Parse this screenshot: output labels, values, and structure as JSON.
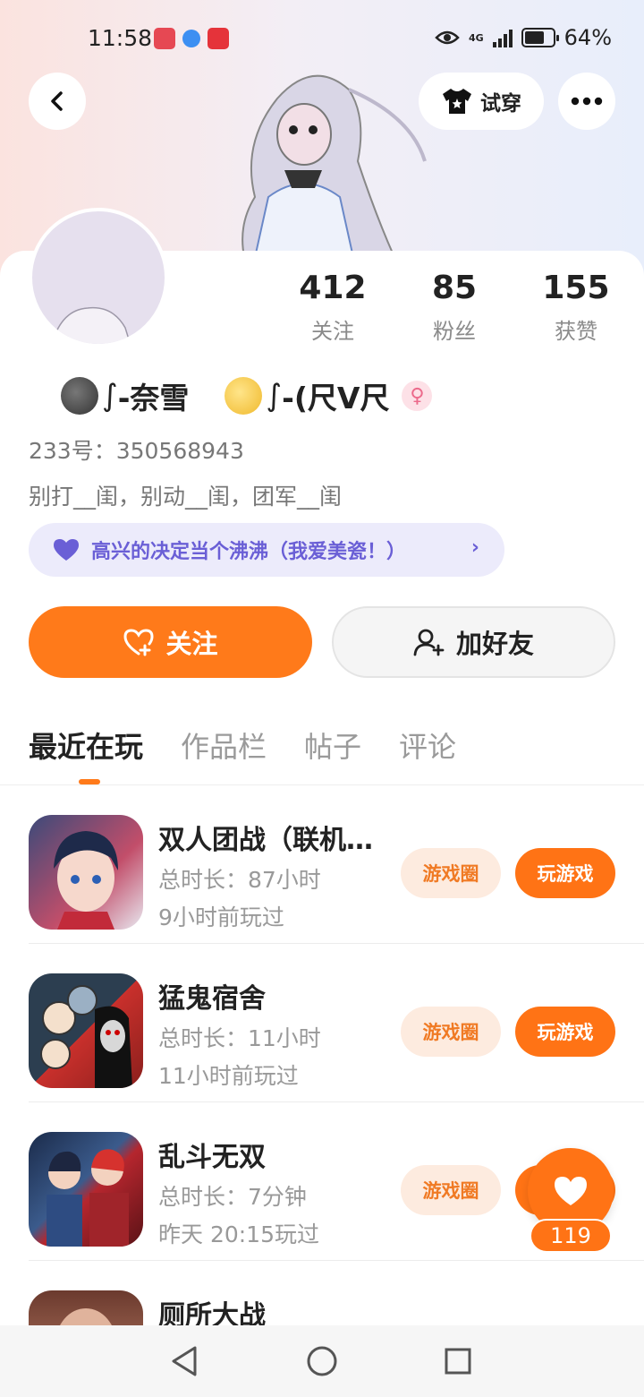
{
  "status_bar": {
    "time": "11:58",
    "signal_label": "4G",
    "battery": "64%"
  },
  "header": {
    "try_on_label": "试穿"
  },
  "stats": [
    {
      "value": "412",
      "label": "关注"
    },
    {
      "value": "85",
      "label": "粉丝"
    },
    {
      "value": "155",
      "label": "获赞"
    }
  ],
  "profile": {
    "name_part1": "-奈雪",
    "name_part2": "-(尺V尺",
    "gender": "♀",
    "id_line": "233号：350568943",
    "bio": "别打__闺，别动__闺，团军__闺",
    "signature": "高兴的决定当个沸沸（我爱美瓷！）"
  },
  "actions": {
    "follow": "关注",
    "add_friend": "加好友"
  },
  "tabs": [
    {
      "label": "最近在玩"
    },
    {
      "label": "作品栏"
    },
    {
      "label": "帖子"
    },
    {
      "label": "评论"
    }
  ],
  "games": [
    {
      "title": "双人团战（联机版）",
      "duration": "总时长：87小时",
      "last_played": "9小时前玩过"
    },
    {
      "title": "猛鬼宿舍",
      "duration": "总时长：11小时",
      "last_played": "11小时前玩过"
    },
    {
      "title": "乱斗无双",
      "duration": "总时长：7分钟",
      "last_played": "昨天 20:15玩过"
    },
    {
      "title": "厕所大战",
      "duration": "",
      "last_played": ""
    }
  ],
  "game_buttons": {
    "circle": "游戏圈",
    "play": "玩游戏"
  },
  "like_fab": {
    "count": "119"
  },
  "colors": {
    "accent": "#ff7315",
    "accent_light": "#fdebdf",
    "purple": "#6a5fd6"
  }
}
